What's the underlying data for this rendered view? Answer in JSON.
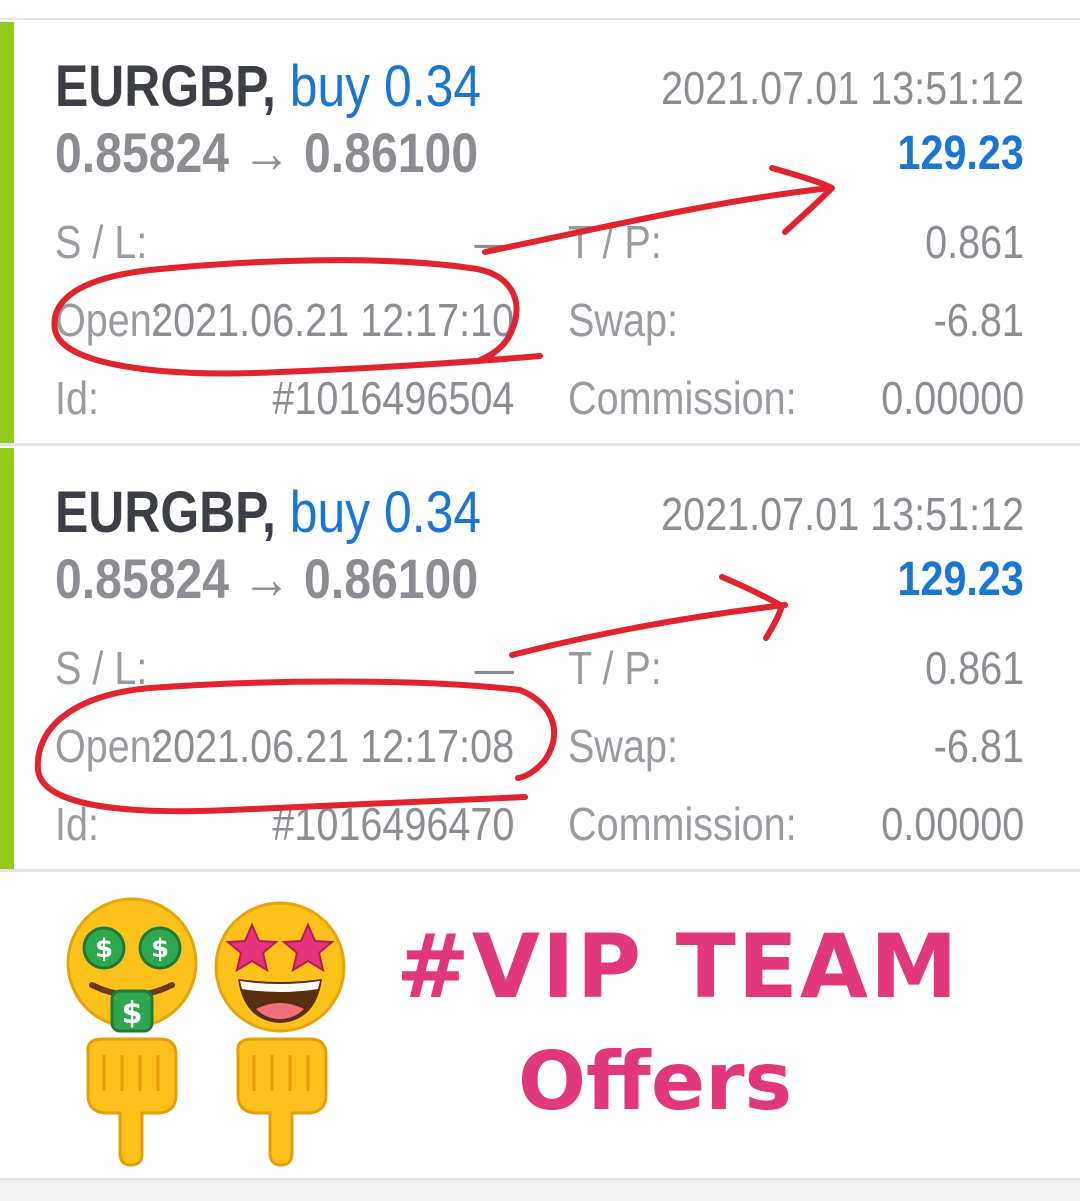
{
  "trades": [
    {
      "symbol": "EURGBP,",
      "side": "buy 0.34",
      "close_time": "2021.07.01 13:51:12",
      "open_price": "0.85824",
      "arrow": "→",
      "close_price": "0.86100",
      "profit": "129.23",
      "sl_label": "S / L:",
      "sl_value": "—",
      "tp_label": "T / P:",
      "tp_value": "0.861",
      "open_label": "Open:",
      "open_time": "2021.06.21 12:17:10",
      "swap_label": "Swap:",
      "swap_value": "-6.81",
      "id_label": "Id:",
      "id_value": "#1016496504",
      "commission_label": "Commission:",
      "commission_value": "0.00000"
    },
    {
      "symbol": "EURGBP,",
      "side": "buy 0.34",
      "close_time": "2021.07.01 13:51:12",
      "open_price": "0.85824",
      "arrow": "→",
      "close_price": "0.86100",
      "profit": "129.23",
      "sl_label": "S / L:",
      "sl_value": "—",
      "tp_label": "T / P:",
      "tp_value": "0.861",
      "open_label": "Open:",
      "open_time": "2021.06.21 12:17:08",
      "swap_label": "Swap:",
      "swap_value": "-6.81",
      "id_label": "Id:",
      "id_value": "#1016496470",
      "commission_label": "Commission:",
      "commission_value": "0.00000"
    }
  ],
  "colors": {
    "accent": "#8fcc1a",
    "blue": "#1976d2",
    "annotation": "#e0232c",
    "promo": "#e1387b"
  },
  "promo": {
    "title": "#VIP TEAM",
    "subtitle": "Offers",
    "icons": [
      "money-mouth-face-icon",
      "star-struck-face-icon",
      "pointing-down-hand-icon",
      "pointing-down-hand-icon"
    ]
  }
}
